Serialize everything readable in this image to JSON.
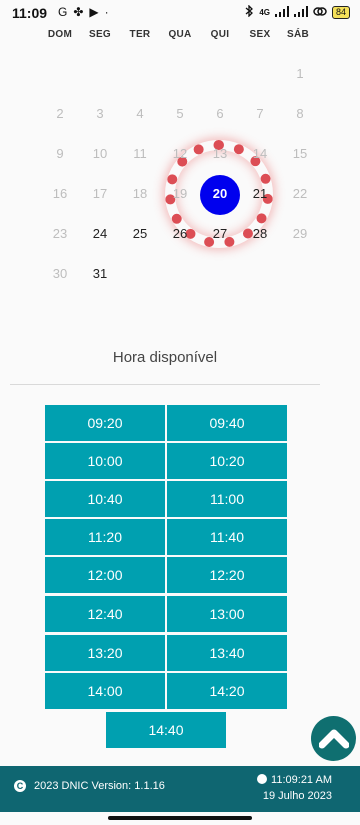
{
  "status_bar": {
    "time": "11:09",
    "left_icons": [
      "G",
      "✤",
      "▶",
      "·"
    ],
    "right_text": "4G",
    "battery": "84"
  },
  "calendar": {
    "weekdays": [
      "DOM",
      "SEG",
      "TER",
      "QUA",
      "QUI",
      "SEX",
      "SÁB"
    ],
    "selected_day": "20",
    "weeks": [
      [
        null,
        null,
        null,
        null,
        null,
        null,
        {
          "d": "1",
          "active": false
        }
      ],
      [
        {
          "d": "2",
          "active": false
        },
        {
          "d": "3",
          "active": false
        },
        {
          "d": "4",
          "active": false
        },
        {
          "d": "5",
          "active": false
        },
        {
          "d": "6",
          "active": false
        },
        {
          "d": "7",
          "active": false
        },
        {
          "d": "8",
          "active": false
        }
      ],
      [
        {
          "d": "9",
          "active": false
        },
        {
          "d": "10",
          "active": false
        },
        {
          "d": "11",
          "active": false
        },
        {
          "d": "12",
          "active": false
        },
        {
          "d": "13",
          "active": false
        },
        {
          "d": "14",
          "active": false
        },
        {
          "d": "15",
          "active": false
        }
      ],
      [
        {
          "d": "16",
          "active": false
        },
        {
          "d": "17",
          "active": false
        },
        {
          "d": "18",
          "active": false
        },
        {
          "d": "19",
          "active": false
        },
        {
          "d": "20",
          "active": true,
          "selected": true
        },
        {
          "d": "21",
          "active": true
        },
        {
          "d": "22",
          "active": false
        }
      ],
      [
        {
          "d": "23",
          "active": false
        },
        {
          "d": "24",
          "active": true
        },
        {
          "d": "25",
          "active": true
        },
        {
          "d": "26",
          "active": true
        },
        {
          "d": "27",
          "active": true
        },
        {
          "d": "28",
          "active": true
        },
        {
          "d": "29",
          "active": false
        }
      ],
      [
        {
          "d": "30",
          "active": false
        },
        {
          "d": "31",
          "active": true
        },
        null,
        null,
        null,
        null,
        null
      ]
    ]
  },
  "slots_section": {
    "title": "Hora disponível",
    "times": [
      "09:20",
      "09:40",
      "10:00",
      "10:20",
      "10:40",
      "11:00",
      "11:20",
      "11:40",
      "12:00",
      "12:20",
      "12:40",
      "13:00",
      "13:20",
      "13:40",
      "14:00",
      "14:20",
      "14:40"
    ]
  },
  "footer": {
    "copyright_symbol": "C",
    "copyright": "2023 DNIC  Version: 1.1.16",
    "clock": "11:09:21 AM",
    "date": "19 Julho 2023"
  },
  "colors": {
    "slot_bg": "#00a0b0",
    "footer_bg": "#0f6671",
    "selected_day": "#0000ee",
    "highlight_ring": "#d2141e"
  }
}
